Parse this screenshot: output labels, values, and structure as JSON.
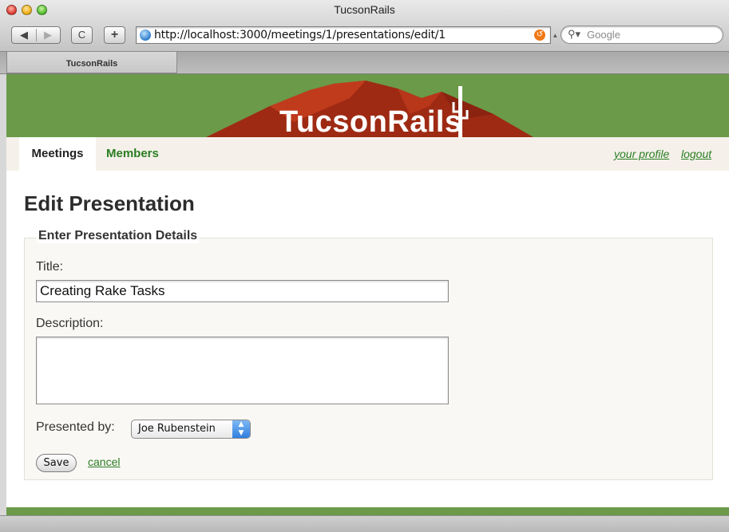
{
  "window": {
    "title": "TucsonRails"
  },
  "toolbar": {
    "back_symbol": "◀",
    "forward_symbol": "▶",
    "reload_symbol": "C",
    "add_symbol": "+",
    "url": "http://localhost:3000/meetings/1/presentations/edit/1",
    "search_placeholder": "Google"
  },
  "tabs": [
    {
      "label": "TucsonRails"
    }
  ],
  "site": {
    "logo": "TucsonRails",
    "nav": {
      "meetings": "Meetings",
      "members": "Members"
    },
    "user_links": {
      "profile": "your profile",
      "logout": "logout"
    }
  },
  "form": {
    "heading": "Edit Presentation",
    "legend": "Enter Presentation Details",
    "title_label": "Title:",
    "title_value": "Creating Rake Tasks",
    "description_label": "Description:",
    "description_value": "",
    "presenter_label": "Presented by:",
    "presenter_selected": "Joe Rubenstein",
    "save_label": "Save",
    "cancel_label": "cancel"
  },
  "colors": {
    "banner_green": "#6b9a49",
    "link_green": "#2a7d23",
    "mountain_red": "#9e2a13"
  }
}
